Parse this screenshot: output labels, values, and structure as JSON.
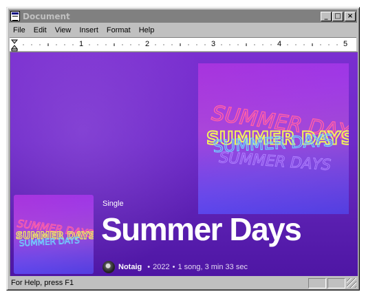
{
  "window": {
    "title": "Document",
    "controls": {
      "minimize": "_",
      "maximize": "□",
      "close": "×"
    }
  },
  "menu": [
    "File",
    "Edit",
    "View",
    "Insert",
    "Format",
    "Help"
  ],
  "ruler": {
    "numbers": [
      "1",
      "2",
      "3",
      "4",
      "5"
    ]
  },
  "release": {
    "type": "Single",
    "title": "Summer Days",
    "artist": "Notaig",
    "year": "2022",
    "details": "1 song, 3 min 33 sec",
    "separator": "•",
    "cover_text": "SUMMER DAYS"
  },
  "status": {
    "text": "For Help, press F1"
  },
  "colors": {
    "background_top": "#7a2fd0",
    "background_bottom": "#4e16a4",
    "cover_text_yellow": "#f2f25a",
    "cover_text_pink": "#ff5fa8",
    "cover_text_cyan": "#6fd6ff"
  }
}
